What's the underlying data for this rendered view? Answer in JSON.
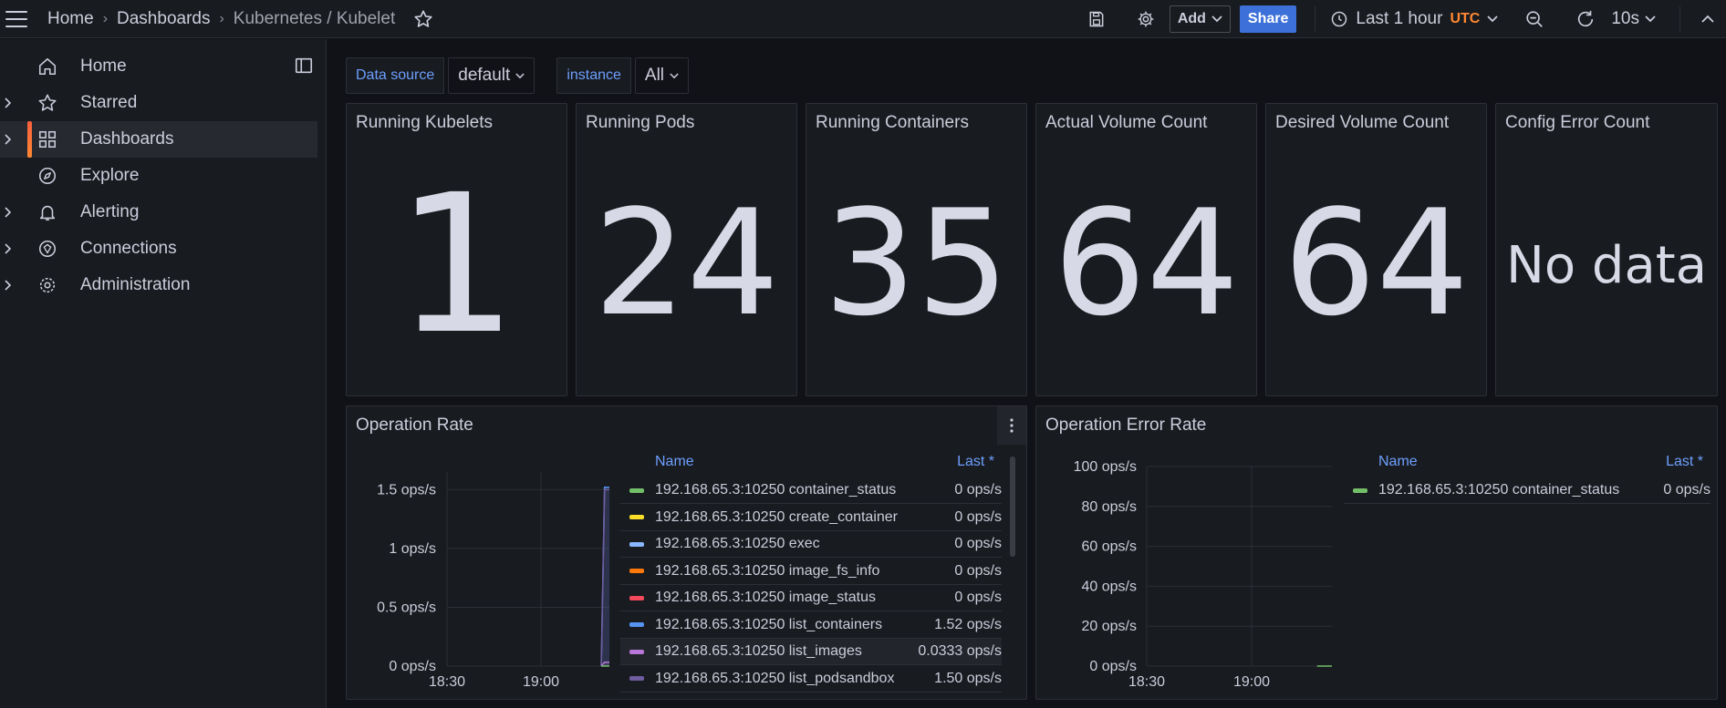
{
  "topbar": {
    "breadcrumbs": [
      "Home",
      "Dashboards",
      "Kubernetes / Kubelet"
    ],
    "add_label": "Add",
    "share_label": "Share",
    "time_range": "Last 1 hour",
    "timezone": "UTC",
    "refresh_interval": "10s"
  },
  "sidebar": {
    "items": [
      {
        "label": "Home",
        "icon": "home-icon",
        "has_children": false
      },
      {
        "label": "Starred",
        "icon": "star-icon",
        "has_children": true
      },
      {
        "label": "Dashboards",
        "icon": "apps-icon",
        "has_children": true,
        "active": true
      },
      {
        "label": "Explore",
        "icon": "compass-icon",
        "has_children": false
      },
      {
        "label": "Alerting",
        "icon": "bell-icon",
        "has_children": true
      },
      {
        "label": "Connections",
        "icon": "connections-icon",
        "has_children": true
      },
      {
        "label": "Administration",
        "icon": "cog-icon",
        "has_children": true
      }
    ]
  },
  "variables": [
    {
      "label": "Data source",
      "value": "default"
    },
    {
      "label": "instance",
      "value": "All"
    }
  ],
  "stats": [
    {
      "title": "Running Kubelets",
      "value": "1"
    },
    {
      "title": "Running Pods",
      "value": "24"
    },
    {
      "title": "Running Containers",
      "value": "35"
    },
    {
      "title": "Actual Volume Count",
      "value": "64"
    },
    {
      "title": "Desired Volume Count",
      "value": "64"
    },
    {
      "title": "Config Error Count",
      "value": "No data"
    }
  ],
  "operation_rate": {
    "title": "Operation Rate",
    "legend_headers": {
      "name": "Name",
      "last": "Last *"
    },
    "legend": [
      {
        "name": "192.168.65.3:10250 container_status",
        "last": "0 ops/s",
        "color": "#73bf69"
      },
      {
        "name": "192.168.65.3:10250 create_container",
        "last": "0 ops/s",
        "color": "#fade2a"
      },
      {
        "name": "192.168.65.3:10250 exec",
        "last": "0 ops/s",
        "color": "#8ab8ff"
      },
      {
        "name": "192.168.65.3:10250 image_fs_info",
        "last": "0 ops/s",
        "color": "#ff780a"
      },
      {
        "name": "192.168.65.3:10250 image_status",
        "last": "0 ops/s",
        "color": "#f2495c"
      },
      {
        "name": "192.168.65.3:10250 list_containers",
        "last": "1.52 ops/s",
        "color": "#5794f2"
      },
      {
        "name": "192.168.65.3:10250 list_images",
        "last": "0.0333 ops/s",
        "color": "#b877d9"
      },
      {
        "name": "192.168.65.3:10250 list_podsandbox",
        "last": "1.50 ops/s",
        "color": "#705da0"
      }
    ]
  },
  "operation_error_rate": {
    "title": "Operation Error Rate",
    "legend_headers": {
      "name": "Name",
      "last": "Last *"
    },
    "legend": [
      {
        "name": "192.168.65.3:10250 container_status",
        "last": "0 ops/s",
        "color": "#73bf69"
      }
    ]
  },
  "chart_data": [
    {
      "type": "line",
      "title": "Operation Rate",
      "x_ticks": [
        "18:30",
        "19:00"
      ],
      "y_ticks": [
        "0 ops/s",
        "0.5 ops/s",
        "1 ops/s",
        "1.5 ops/s"
      ],
      "ylim": [
        0,
        1.65
      ],
      "x": [
        0,
        0.95,
        0.97,
        1.0
      ],
      "series": [
        {
          "name": "192.168.65.3:10250 list_containers",
          "values": [
            null,
            0,
            1.52,
            1.52
          ]
        },
        {
          "name": "192.168.65.3:10250 list_podsandbox",
          "values": [
            null,
            0,
            1.5,
            1.5
          ]
        },
        {
          "name": "192.168.65.3:10250 list_images",
          "values": [
            null,
            0,
            0.0333,
            0.0333
          ]
        },
        {
          "name": "192.168.65.3:10250 container_status",
          "values": [
            null,
            0,
            0,
            0
          ]
        }
      ]
    },
    {
      "type": "line",
      "title": "Operation Error Rate",
      "x_ticks": [
        "18:30",
        "19:00"
      ],
      "y_ticks": [
        "0 ops/s",
        "20 ops/s",
        "40 ops/s",
        "60 ops/s",
        "80 ops/s",
        "100 ops/s"
      ],
      "ylim": [
        0,
        100
      ],
      "x": [
        0.92,
        1.0
      ],
      "series": [
        {
          "name": "192.168.65.3:10250 container_status",
          "values": [
            0,
            0
          ]
        }
      ]
    }
  ]
}
